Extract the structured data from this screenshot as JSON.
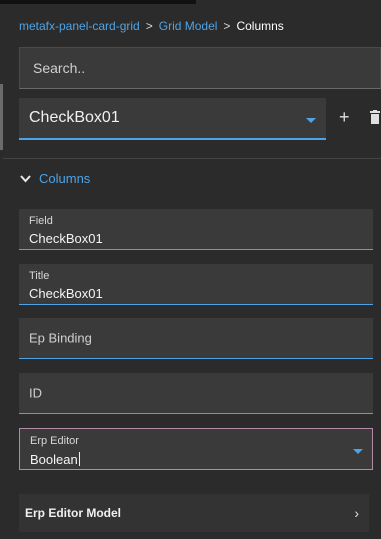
{
  "breadcrumb": {
    "items": [
      "metafx-panel-card-grid",
      "Grid Model"
    ],
    "separator": ">",
    "current": "Columns"
  },
  "search": {
    "placeholder": "Search.."
  },
  "selector": {
    "value": "CheckBox01"
  },
  "actions": {
    "add_icon": "plus-icon",
    "delete_icon": "trash-icon",
    "add_glyph": "+"
  },
  "section": {
    "label": "Columns",
    "icon": "chevron-down-icon"
  },
  "fields": {
    "field": {
      "label": "Field",
      "value": "CheckBox01"
    },
    "title": {
      "label": "Title",
      "value": "CheckBox01"
    },
    "ep_binding": {
      "placeholder": "Ep Binding"
    },
    "id": {
      "placeholder": "ID"
    },
    "erp_editor": {
      "label": "Erp Editor",
      "value": "Boolean"
    }
  },
  "erp_editor_model": {
    "label": "Erp Editor Model",
    "chevron": "›"
  },
  "colors": {
    "accent": "#4ea3e6",
    "background": "#2b2b2b",
    "field_bg": "#3a3a3a",
    "focus_border": "#b58aa8"
  }
}
